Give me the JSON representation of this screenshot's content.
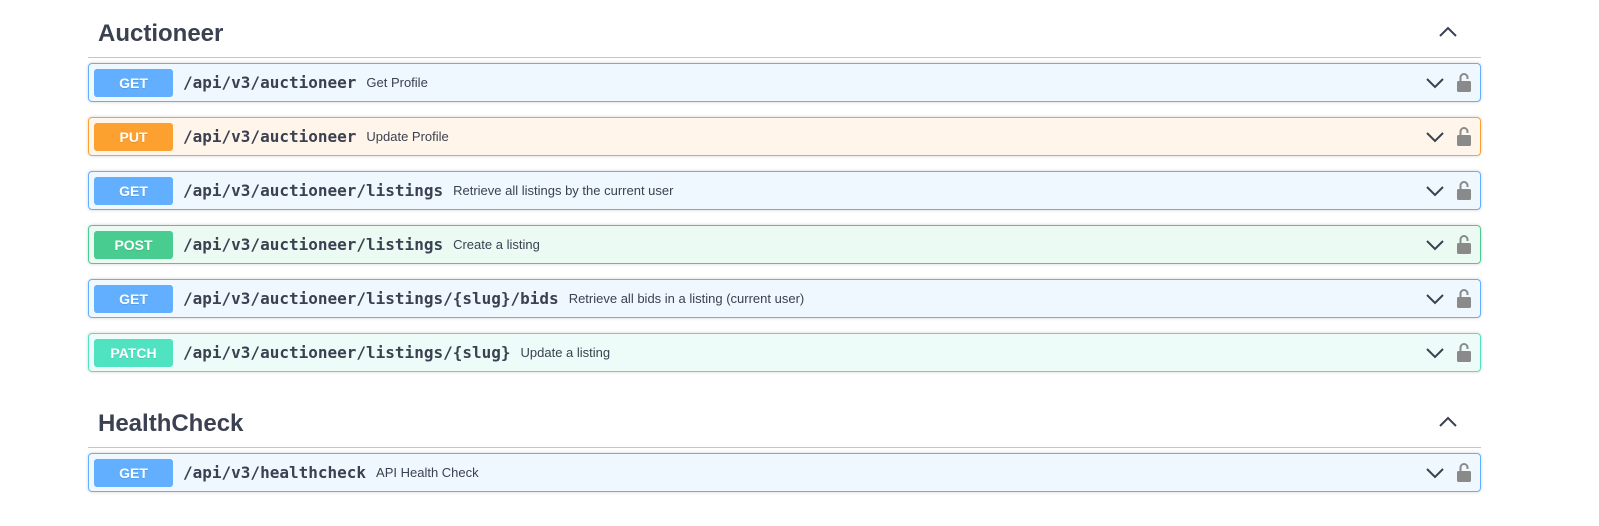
{
  "sections": [
    {
      "title": "Auctioneer",
      "operations": [
        {
          "method": "GET",
          "path": "/api/v3/auctioneer",
          "summary": "Get Profile"
        },
        {
          "method": "PUT",
          "path": "/api/v3/auctioneer",
          "summary": "Update Profile"
        },
        {
          "method": "GET",
          "path": "/api/v3/auctioneer/listings",
          "summary": "Retrieve all listings by the current user"
        },
        {
          "method": "POST",
          "path": "/api/v3/auctioneer/listings",
          "summary": "Create a listing"
        },
        {
          "method": "GET",
          "path": "/api/v3/auctioneer/listings/{slug}/bids",
          "summary": "Retrieve all bids in a listing (current user)"
        },
        {
          "method": "PATCH",
          "path": "/api/v3/auctioneer/listings/{slug}",
          "summary": "Update a listing"
        }
      ]
    },
    {
      "title": "HealthCheck",
      "operations": [
        {
          "method": "GET",
          "path": "/api/v3/healthcheck",
          "summary": "API Health Check"
        }
      ]
    }
  ],
  "colors": {
    "get": "#61affe",
    "put": "#fca130",
    "post": "#49cc90",
    "patch": "#50e3c2",
    "text": "#3b4151"
  },
  "icons": {
    "section_toggle": "chevron-up-icon",
    "expand": "chevron-down-icon",
    "authorize": "lock-icon"
  }
}
